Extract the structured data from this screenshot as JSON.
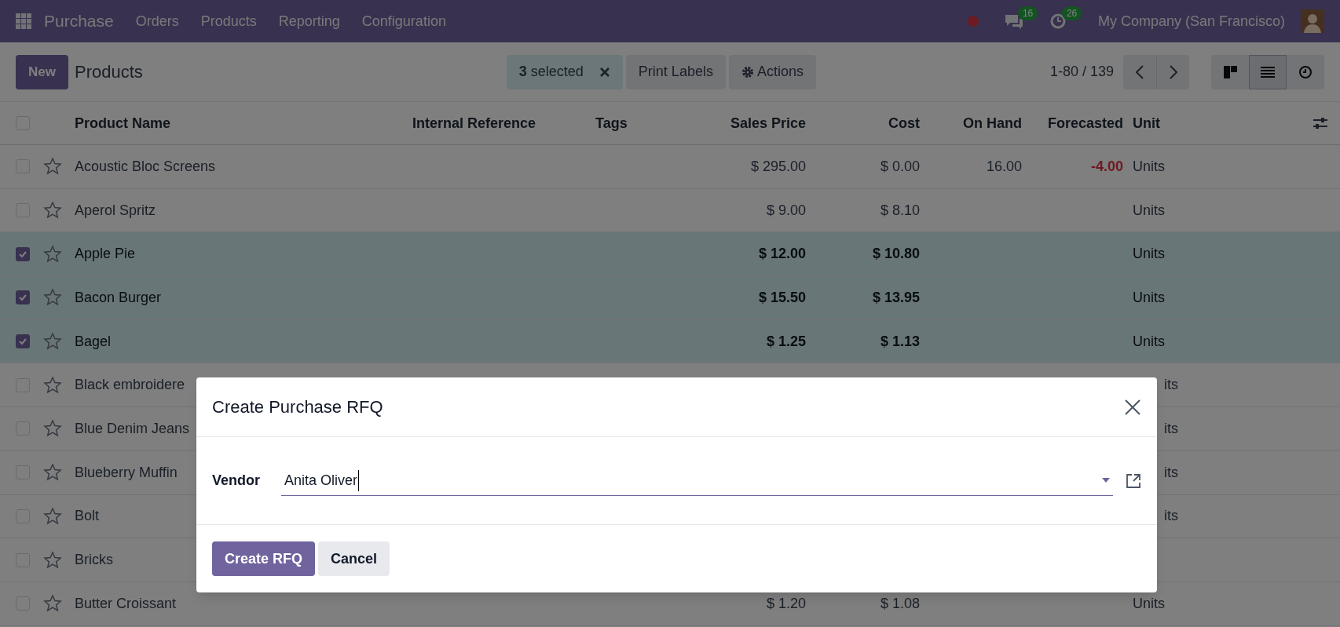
{
  "navbar": {
    "app": "Purchase",
    "menu": [
      "Orders",
      "Products",
      "Reporting",
      "Configuration"
    ],
    "messages_count": "16",
    "activities_count": "26",
    "company": "My Company (San Francisco)"
  },
  "control_panel": {
    "new_button": "New",
    "title": "Products",
    "selection_count": "3",
    "selection_label": "selected",
    "actions": [
      "Print Labels",
      "Actions"
    ],
    "pager": "1-80 / 139",
    "views": [
      {
        "kind": "kanban",
        "selected": false
      },
      {
        "kind": "list",
        "selected": true
      },
      {
        "kind": "activity",
        "selected": false
      }
    ]
  },
  "table": {
    "header_checked": false,
    "columns": [
      "Product Name",
      "Internal Reference",
      "Tags",
      "Sales Price",
      "Cost",
      "On Hand",
      "Forecasted",
      "Unit"
    ],
    "rows": [
      {
        "checked": false,
        "favorite": false,
        "covered": false,
        "name": "Acoustic Bloc Screens",
        "sales_price": "$ 295.00",
        "cost": "$ 0.00",
        "on_hand": "16.00",
        "forecasted": "-4.00",
        "forecast_negative": true,
        "unit": "Units"
      },
      {
        "checked": false,
        "favorite": false,
        "covered": false,
        "name": "Aperol Spritz",
        "sales_price": "$ 9.00",
        "cost": "$ 8.10",
        "unit": "Units"
      },
      {
        "checked": true,
        "favorite": false,
        "covered": false,
        "name": "Apple Pie",
        "sales_price": "$ 12.00",
        "cost": "$ 10.80",
        "unit": "Units"
      },
      {
        "checked": true,
        "favorite": false,
        "covered": false,
        "name": "Bacon Burger",
        "sales_price": "$ 15.50",
        "cost": "$ 13.95",
        "unit": "Units"
      },
      {
        "checked": true,
        "favorite": false,
        "covered": false,
        "name": "Bagel",
        "sales_price": "$ 1.25",
        "cost": "$ 1.13",
        "unit": "Units"
      },
      {
        "checked": false,
        "favorite": false,
        "covered": true,
        "name": "Black embroidere",
        "unit": "its"
      },
      {
        "checked": false,
        "favorite": false,
        "covered": true,
        "name": "Blue Denim Jeans",
        "unit": "its"
      },
      {
        "checked": false,
        "favorite": false,
        "covered": true,
        "name": "Blueberry Muffin",
        "unit": "its"
      },
      {
        "checked": false,
        "favorite": false,
        "covered": true,
        "name": "Bolt",
        "unit": "its"
      },
      {
        "checked": false,
        "favorite": false,
        "name": "Bricks"
      },
      {
        "checked": false,
        "favorite": false,
        "covered": false,
        "name": "Butter Croissant",
        "sales_price": "$ 1.20",
        "cost": "$ 1.08",
        "unit": "Units"
      }
    ]
  },
  "dialog": {
    "title": "Create Purchase RFQ",
    "field_label": "Vendor",
    "field_value": "Anita Oliver",
    "buttons": [
      {
        "label": "Create RFQ",
        "kind": "primary"
      },
      {
        "label": "Cancel",
        "kind": "secondary"
      }
    ]
  }
}
